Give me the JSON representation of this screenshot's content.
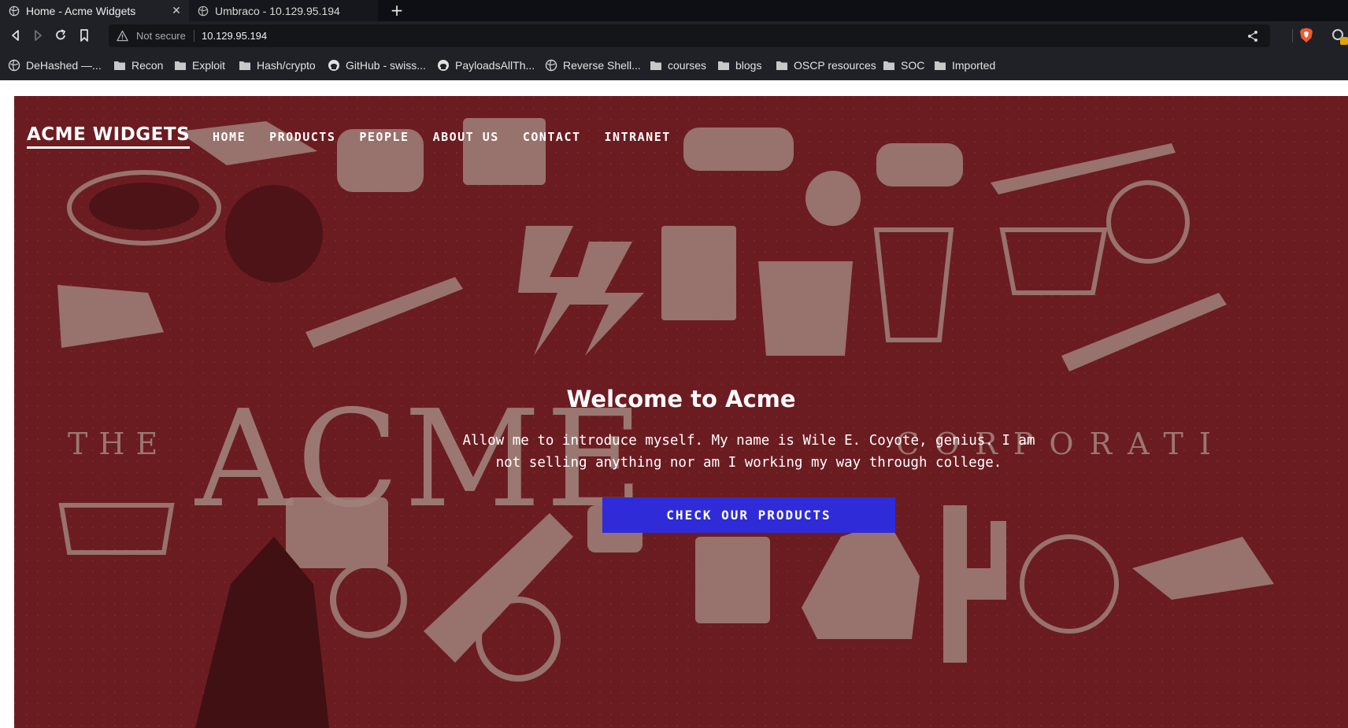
{
  "browser": {
    "tabs": [
      {
        "title": "Home - Acme Widgets",
        "close_glyph": "✕"
      },
      {
        "title": "Umbraco - 10.129.95.194"
      }
    ],
    "new_tab_glyph": "+",
    "address": {
      "security_label": "Not secure",
      "url": "10.129.95.194"
    },
    "bookmarks": [
      {
        "label": "DeHashed —...",
        "icon": "globe-icon"
      },
      {
        "label": "Recon",
        "icon": "folder-icon"
      },
      {
        "label": "Exploit",
        "icon": "folder-icon"
      },
      {
        "label": "Hash/crypto",
        "icon": "folder-icon"
      },
      {
        "label": "GitHub - swiss...",
        "icon": "github-icon"
      },
      {
        "label": "PayloadsAllTh...",
        "icon": "github-icon"
      },
      {
        "label": "Reverse Shell...",
        "icon": "globe-icon"
      },
      {
        "label": "courses",
        "icon": "folder-icon"
      },
      {
        "label": "blogs",
        "icon": "folder-icon"
      },
      {
        "label": "OSCP resources",
        "icon": "folder-icon"
      },
      {
        "label": "SOC",
        "icon": "folder-icon"
      },
      {
        "label": "Imported",
        "icon": "folder-icon"
      }
    ]
  },
  "site": {
    "brand": "ACME WIDGETS",
    "nav": [
      "HOME",
      "PRODUCTS",
      "PEOPLE",
      "ABOUT US",
      "CONTACT",
      "INTRANET"
    ],
    "hero": {
      "background_text_left": "THE",
      "background_text_big": "ACME",
      "background_text_right": "CORPORATI",
      "heading": "Welcome to Acme",
      "intro": "Allow me to introduce myself. My name is Wile E. Coyote, genius. I am not selling anything nor am I working my way through college.",
      "cta": "CHECK OUR PRODUCTS"
    }
  },
  "colors": {
    "hero_background": "#6b1c21",
    "hero_artwork": "#a0827a",
    "cta_background": "#2f2bd9",
    "browser_chrome": "#1f2127",
    "tab_strip": "#0d0f14"
  }
}
